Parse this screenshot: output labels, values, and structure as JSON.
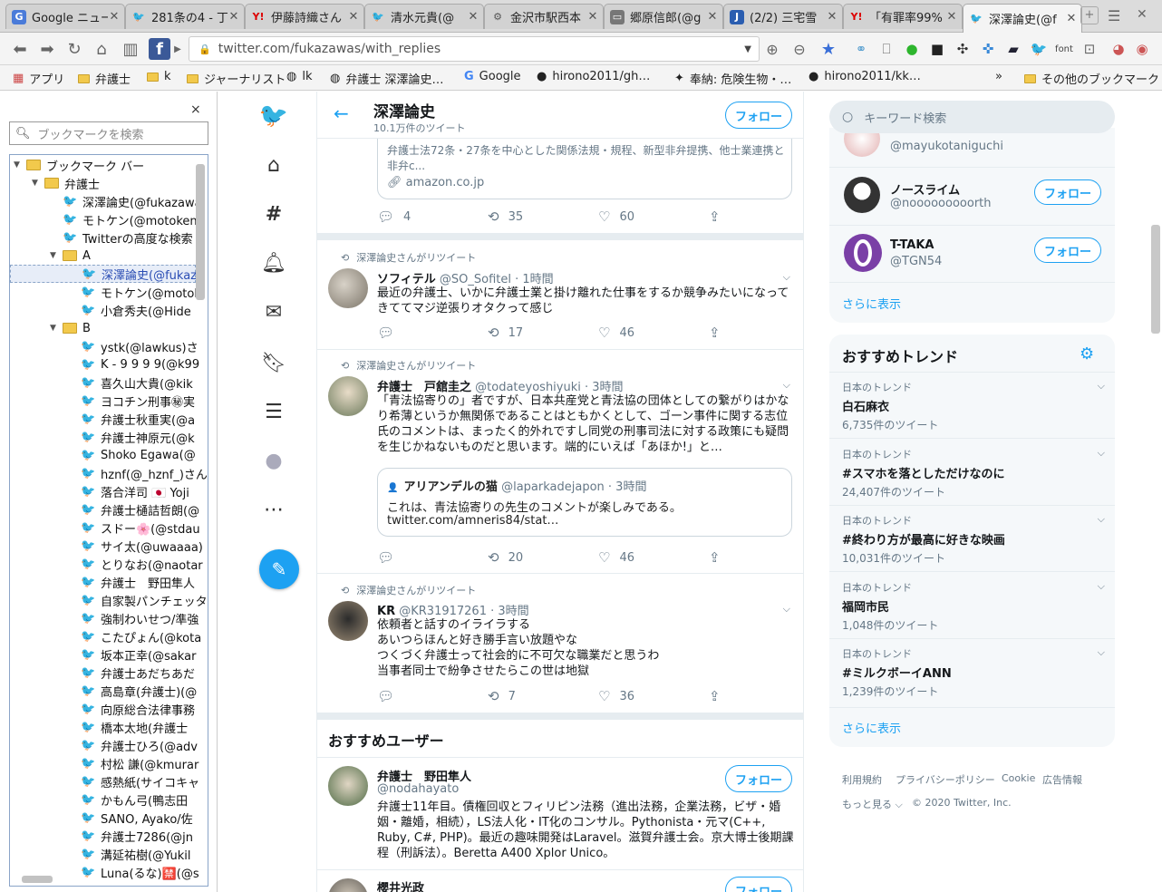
{
  "browser": {
    "tabs": [
      {
        "label": "Google ニュー",
        "icon": "google-news-icon"
      },
      {
        "label": "281条の4 - 丁",
        "icon": "twitter-icon"
      },
      {
        "label": "伊藤詩織さん",
        "icon": "yahoo-icon"
      },
      {
        "label": "清水元貴(@",
        "icon": "twitter-icon"
      },
      {
        "label": "金沢市駅西本",
        "icon": "generic-icon"
      },
      {
        "label": "郷原信郎(@g",
        "icon": "folder-icon"
      },
      {
        "label": "(2/2) 三宅雪",
        "icon": "j-icon"
      },
      {
        "label": "「有罪率99%",
        "icon": "yahoo-icon"
      },
      {
        "label": "深澤論史(@f",
        "icon": "twitter-icon"
      }
    ],
    "url": "twitter.com/fukazawas/with_replies",
    "bookmarks_bar": [
      {
        "label": "アプリ"
      },
      {
        "label": "弁護士"
      },
      {
        "label": "k"
      },
      {
        "label": "ジャーナリスト"
      },
      {
        "label": "lk"
      },
      {
        "label": "弁護士 深澤論史…"
      },
      {
        "label": "Google"
      },
      {
        "label": "hirono2011/gh…"
      },
      {
        "label": "奉納: 危険生物・…"
      },
      {
        "label": "hirono2011/kk…"
      },
      {
        "label": "その他のブックマーク"
      }
    ],
    "more_label": "»",
    "toolbar_icons": [
      "font"
    ]
  },
  "sidepanel": {
    "close": "×",
    "search_placeholder": "ブックマークを検索",
    "tree": [
      {
        "label": "ブックマーク バー",
        "type": "folder",
        "depth": 0,
        "open": true
      },
      {
        "label": "弁護士",
        "type": "folder",
        "depth": 1,
        "open": true
      },
      {
        "label": "深澤論史(@fukazawa",
        "type": "tw",
        "depth": 2
      },
      {
        "label": "モトケン(@motoken_",
        "type": "tw",
        "depth": 2
      },
      {
        "label": "Twitterの高度な検索",
        "type": "tw",
        "depth": 2
      },
      {
        "label": "A",
        "type": "folder",
        "depth": 2,
        "open": true
      },
      {
        "label": "深澤論史(@fukaz",
        "type": "tw",
        "depth": 3,
        "selected": true
      },
      {
        "label": "モトケン(@motok",
        "type": "tw",
        "depth": 3
      },
      {
        "label": "小倉秀夫(@Hide",
        "type": "tw",
        "depth": 3
      },
      {
        "label": "B",
        "type": "folder",
        "depth": 2,
        "open": true
      },
      {
        "label": "ystk(@lawkus)さ",
        "type": "tw",
        "depth": 3
      },
      {
        "label": "K - 9 9 9 9(@k99",
        "type": "tw",
        "depth": 3
      },
      {
        "label": "喜久山大貴(@kik",
        "type": "tw",
        "depth": 3
      },
      {
        "label": "ヨコチン刑事㊙実",
        "type": "tw",
        "depth": 3
      },
      {
        "label": "弁護士秋重実(@a",
        "type": "tw",
        "depth": 3
      },
      {
        "label": "弁護士神原元(@k",
        "type": "tw",
        "depth": 3
      },
      {
        "label": "Shoko Egawa(@",
        "type": "tw",
        "depth": 3
      },
      {
        "label": "hznf(@_hznf_)さん",
        "type": "tw",
        "depth": 3
      },
      {
        "label": "落合洋司 🇯🇵 Yoji",
        "type": "tw",
        "depth": 3
      },
      {
        "label": "弁護士樋詰哲朗(@",
        "type": "tw",
        "depth": 3
      },
      {
        "label": "スドー🌸(@stdau",
        "type": "tw",
        "depth": 3
      },
      {
        "label": "サイ太(@uwaaaa)",
        "type": "tw",
        "depth": 3
      },
      {
        "label": "とりなお(@naotar",
        "type": "tw",
        "depth": 3
      },
      {
        "label": "弁護士　野田隼人",
        "type": "tw",
        "depth": 3
      },
      {
        "label": "自家製パンチェッタ",
        "type": "tw",
        "depth": 3
      },
      {
        "label": "強制わいせつ/準強",
        "type": "tw",
        "depth": 3
      },
      {
        "label": "こたぴょん(@kota",
        "type": "tw",
        "depth": 3
      },
      {
        "label": "坂本正幸(@sakar",
        "type": "tw",
        "depth": 3
      },
      {
        "label": "弁護士あだちあだ",
        "type": "tw",
        "depth": 3
      },
      {
        "label": "高島章(弁護士)(@",
        "type": "tw",
        "depth": 3
      },
      {
        "label": "向原総合法律事務",
        "type": "tw",
        "depth": 3
      },
      {
        "label": "橋本太地(弁護士",
        "type": "tw",
        "depth": 3
      },
      {
        "label": "弁護士ひろ(@adv",
        "type": "tw",
        "depth": 3
      },
      {
        "label": "村松 謙(@kmurar",
        "type": "tw",
        "depth": 3
      },
      {
        "label": "感熱紙(サイコキャ",
        "type": "tw",
        "depth": 3
      },
      {
        "label": "かもん弓(鴨志田",
        "type": "tw",
        "depth": 3
      },
      {
        "label": "SANO, Ayako/佐",
        "type": "tw",
        "depth": 3
      },
      {
        "label": "弁護士7286(@jn",
        "type": "tw",
        "depth": 3
      },
      {
        "label": "溝延祐樹(@Yukil",
        "type": "tw",
        "depth": 3
      },
      {
        "label": "Luna(るな)🈲(@s",
        "type": "tw",
        "depth": 3
      }
    ]
  },
  "header": {
    "name": "深澤論史",
    "tweet_count": "10.1万件のツイート",
    "follow": "フォロー"
  },
  "tweets": [
    {
      "card_text": "弁護士法72条・27条を中心とした関係法規・規程、新型非弁提携、他士業連携と非弁c...",
      "card_link": "amazon.co.jp",
      "reply": "4",
      "retweet": "35",
      "like": "60"
    },
    {
      "rt_label": "深澤論史さんがリツイート",
      "name": "ソフィテル",
      "handle": "@SO_Sofitel",
      "time": "· 1時間",
      "text": "最近の弁護士、いかに弁護士業と掛け離れた仕事をするか競争みたいになってきててマジ逆張りオタクって感じ",
      "reply": "",
      "retweet": "17",
      "like": "46"
    },
    {
      "rt_label": "深澤論史さんがリツイート",
      "name": "弁護士　戸舘圭之",
      "handle": "@todateyoshiyuki",
      "time": "· 3時間",
      "text": "「青法協寄りの」者ですが、日本共産党と青法協の団体としての繋がりはかなり希薄というか無関係であることはともかくとして、ゴーン事件に関する志位氏のコメントは、まったく的外れですし同党の刑事司法に対する政策にも疑問を生じかねないものだと思います。端的にいえば「あほか!」と…",
      "quote_name": "アリアンデルの猫",
      "quote_handle": "@laparkadejapon",
      "quote_time": "· 3時間",
      "quote_text": "これは、青法協寄りの先生のコメントが楽しみである。",
      "quote_link": "twitter.com/amneris84/stat…",
      "reply": "",
      "retweet": "20",
      "like": "46"
    },
    {
      "rt_label": "深澤論史さんがリツイート",
      "name": "KR",
      "handle": "@KR31917261",
      "time": "· 3時間",
      "lines": [
        "依頼者と話すのイライラする",
        "あいつらほんと好き勝手言い放題やな",
        "つくづく弁護士って社会的に不可欠な職業だと思うわ",
        "当事者同士で紛争させたらこの世は地獄"
      ],
      "reply": "",
      "retweet": "7",
      "like": "36"
    }
  ],
  "suggested": {
    "title": "おすすめユーザー",
    "users": [
      {
        "name": "弁護士　野田隼人",
        "handle": "@nodahayato",
        "bio": "弁護士11年目。債権回収とフィリピン法務（進出法務，企業法務，ビザ・婚姻・離婚，相続），LS法人化・IT化のコンサル。Pythonista・元マ(C++, Ruby, C#, PHP)。最近の趣味開発はLaravel。滋賀弁護士会。京大博士後期課程（刑訴法）。Beretta A400 Xplor Unico。",
        "follow": "フォロー"
      },
      {
        "name": "櫻井光政",
        "follow": "フォロー"
      }
    ]
  },
  "right": {
    "search_placeholder": "キーワード検索",
    "who_to_follow": [
      {
        "name": "",
        "handle": "@mayukotaniguchi",
        "follow": "フォロー"
      },
      {
        "name": "ノースライム",
        "handle": "@nooooooooorth",
        "follow": "フォロー"
      },
      {
        "name": "T-TAKA",
        "handle": "@TGN54",
        "follow": "フォロー"
      }
    ],
    "show_more": "さらに表示",
    "trends_title": "おすすめトレンド",
    "trends": [
      {
        "context": "日本のトレンド",
        "title": "白石麻衣",
        "count": "6,735件のツイート"
      },
      {
        "context": "日本のトレンド",
        "title": "#スマホを落としただけなのに",
        "count": "24,407件のツイート"
      },
      {
        "context": "日本のトレンド",
        "title": "#終わり方が最高に好きな映画",
        "count": "10,031件のツイート"
      },
      {
        "context": "日本のトレンド",
        "title": "福岡市民",
        "count": "1,048件のツイート"
      },
      {
        "context": "日本のトレンド",
        "title": "#ミルクボーイANN",
        "count": "1,239件のツイート"
      }
    ],
    "trends_more": "さらに表示",
    "footer": {
      "terms": "利用規約",
      "privacy": "プライバシーポリシー",
      "cookie": "Cookie",
      "ads": "広告情報",
      "more": "もっと見る ⌵",
      "copyright": "© 2020 Twitter, Inc."
    }
  },
  "colors": {
    "twitter_blue": "#1da1f2",
    "text": "#14171a",
    "muted": "#657786"
  }
}
